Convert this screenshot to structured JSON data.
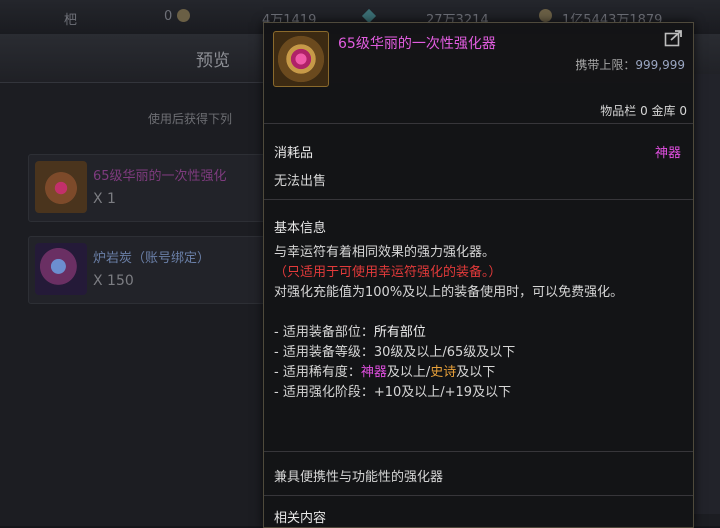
{
  "topbar": {
    "item1_label": "杷",
    "item1_value": "0",
    "item2_value": "4万1419",
    "item3_value": "27万3214",
    "item4_value": "1亿5443万1879"
  },
  "preview": {
    "title": "预览",
    "desc": "使用后获得下列",
    "items": [
      {
        "name": "65级华丽的一次性强化",
        "qty": "X 1"
      },
      {
        "name": "炉岩炭（账号绑定）",
        "qty": "X 150"
      }
    ]
  },
  "tooltip": {
    "title": "65级华丽的一次性强化器",
    "carry_label": "携带上限：",
    "carry_value": "999,999",
    "storage": "物品栏 0 金库 0",
    "category": "消耗品",
    "rarity": "神器",
    "trade": "无法出售",
    "basic_label": "基本信息",
    "desc_line1": "与幸运符有着相同效果的强力强化器。",
    "desc_note": "（只适用于可使用幸运符强化的装备。）",
    "desc_line3": "对强化充能值为100%及以上的装备使用时，可以免费强化。",
    "parts_label": "- 适用装备部位：",
    "parts_value": "所有部位",
    "level_label": "- 适用装备等级：",
    "level_value": "30级及以上/65级及以下",
    "rarity_label": "- 适用稀有度：",
    "rarity_low": "神器",
    "rarity_mid": "及以上/",
    "rarity_high": "史诗",
    "rarity_end": "及以下",
    "stage_label": "- 适用强化阶段：",
    "stage_value": "+10及以上/+19及以下",
    "summary": "兼具便携性与功能性的强化器",
    "related_label": "相关内容"
  },
  "colors": {
    "title_magenta": "#e25de0",
    "note_red": "#e23a3a",
    "epic_orange": "#e8a13a"
  }
}
